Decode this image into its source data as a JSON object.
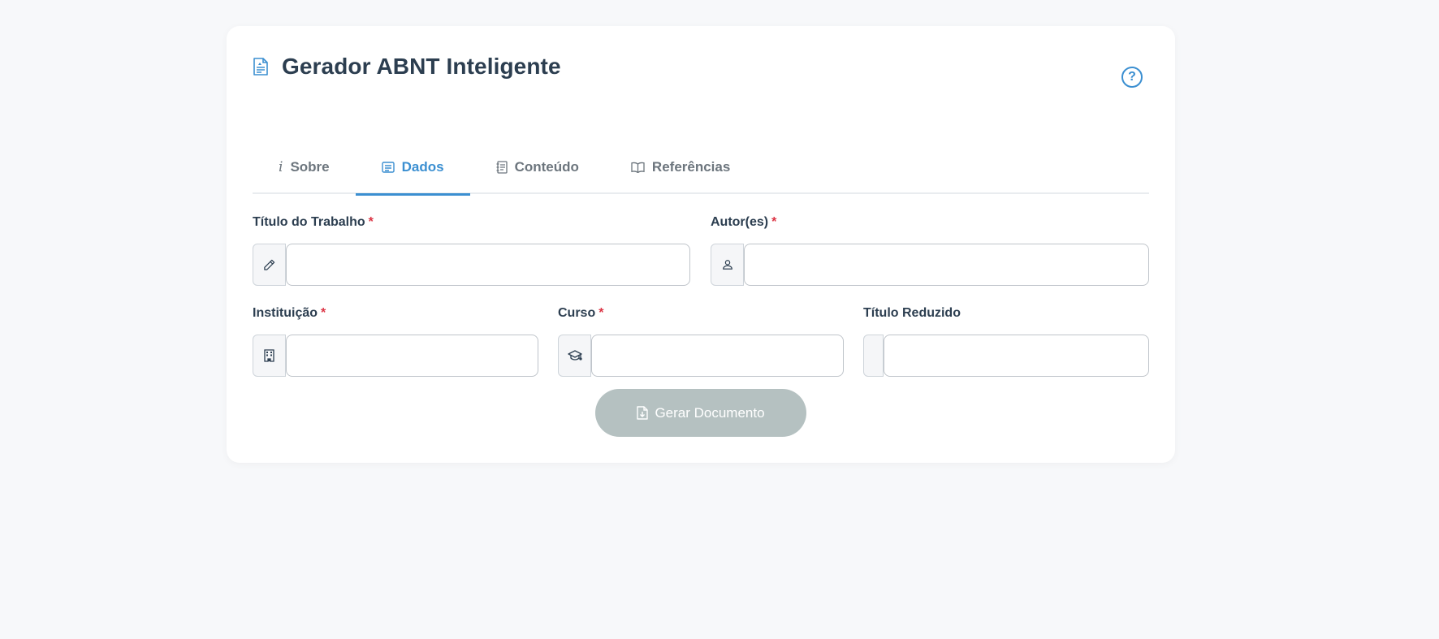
{
  "app": {
    "title": "Gerador ABNT Inteligente",
    "help_symbol": "?"
  },
  "colors": {
    "accent": "#3b8fd1",
    "required": "#dc3545",
    "button_disabled": "#b5c1c1",
    "background": "#f7f8fa"
  },
  "tabs": [
    {
      "label": "Sobre",
      "icon": "info-icon",
      "active": false
    },
    {
      "label": "Dados",
      "icon": "card-text-icon",
      "active": true
    },
    {
      "label": "Conteúdo",
      "icon": "journal-text-icon",
      "active": false
    },
    {
      "label": "Referências",
      "icon": "book-icon",
      "active": false
    }
  ],
  "form": {
    "titulo": {
      "label": "Título do Trabalho",
      "required_mark": "*",
      "value": "",
      "icon": "pencil-icon"
    },
    "autores": {
      "label": "Autor(es)",
      "required_mark": "*",
      "value": "",
      "icon": "person-icon"
    },
    "instituicao": {
      "label": "Instituição",
      "required_mark": "*",
      "value": "",
      "icon": "building-icon"
    },
    "curso": {
      "label": "Curso",
      "required_mark": "*",
      "value": "",
      "icon": "mortarboard-icon"
    },
    "titulo_reduzido": {
      "label": "Título Reduzido",
      "value": ""
    }
  },
  "actions": {
    "generate_label": "Gerar Documento",
    "generate_icon": "file-download-icon"
  }
}
